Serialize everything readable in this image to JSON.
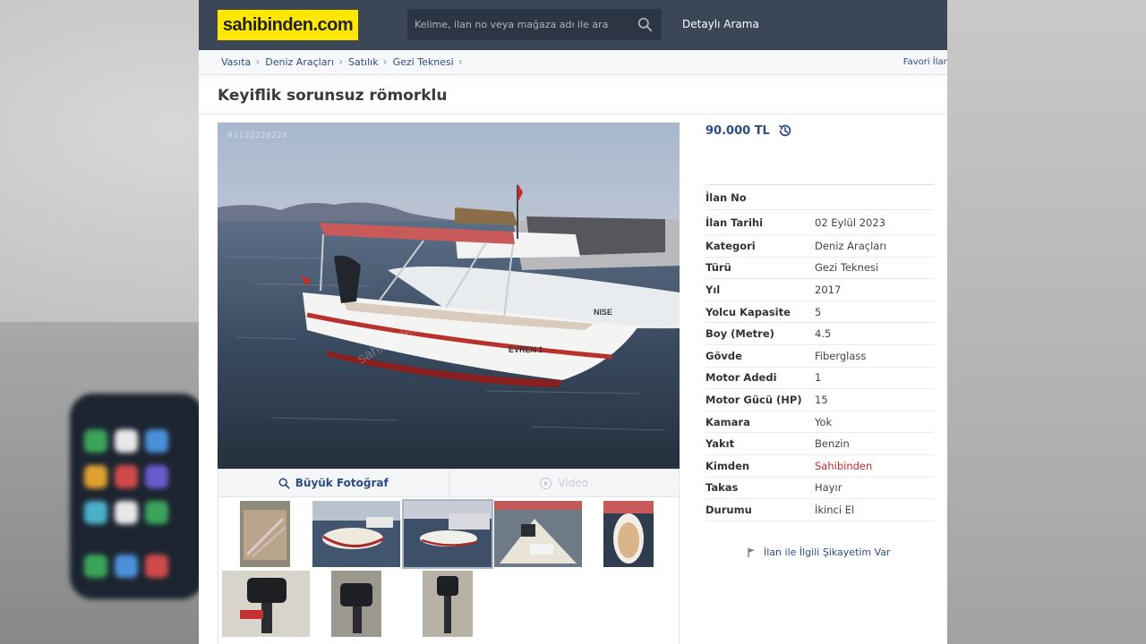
{
  "site": {
    "logo_text": "sahibinden.com",
    "search_placeholder": "Kelime, ilan no veya mağaza adı ile ara",
    "detail_search": "Detaylı Arama"
  },
  "breadcrumb": [
    "Vasıta",
    "Deniz Araçları",
    "Satılık",
    "Gezi Teknesi"
  ],
  "favorite_link": "Favori İlan",
  "listing": {
    "title": "Keyiflik sorunsuz römorklu",
    "image_ad_no": "#1122228224",
    "boat_name": "EVREN 1",
    "price": "90.000 TL",
    "photo_buttons": {
      "large_photo": "Büyük Fotoğraf",
      "video": "Video"
    },
    "complaint": "İlan ile İlgili Şikayetim Var",
    "details": [
      {
        "label": "İlan No",
        "value": ""
      },
      {
        "label": "İlan Tarihi",
        "value": "02 Eylül 2023"
      },
      {
        "label": "Kategori",
        "value": "Deniz Araçları"
      },
      {
        "label": "Türü",
        "value": "Gezi Teknesi"
      },
      {
        "label": "Yıl",
        "value": "2017"
      },
      {
        "label": "Yolcu Kapasite",
        "value": "5"
      },
      {
        "label": "Boy (Metre)",
        "value": "4.5"
      },
      {
        "label": "Gövde",
        "value": "Fiberglass"
      },
      {
        "label": "Motor Adedi",
        "value": "1"
      },
      {
        "label": "Motor Gücü (HP)",
        "value": "15"
      },
      {
        "label": "Kamara",
        "value": "Yok"
      },
      {
        "label": "Yakıt",
        "value": "Benzin"
      },
      {
        "label": "Kimden",
        "value": "Sahibinden"
      },
      {
        "label": "Takas",
        "value": "Hayır"
      },
      {
        "label": "Durumu",
        "value": "İkinci El"
      }
    ]
  },
  "colors": {
    "header": "#3b4657",
    "logo_bg": "#ffe800",
    "link": "#2d4b84",
    "seller_red": "#c02c2c"
  }
}
